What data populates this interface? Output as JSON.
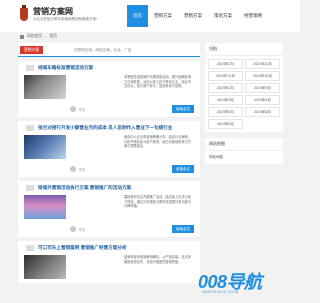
{
  "site": {
    "title": "营销方案网",
    "subtitle": "为企业老板分享实用营销策划和营销方案!"
  },
  "nav": [
    "首页",
    "营销方案",
    "营销方案",
    "策划方案",
    "经营策略"
  ],
  "breadcrumb": [
    "网站首页",
    "首页"
  ],
  "tabs": {
    "active": "营销方案",
    "marquee": "互联网文案、网络文案、社会、广告"
  },
  "posts": [
    {
      "title": "线城车路标准营销活动方案",
      "text": "本季度在各线城市开展营销活动，提升品牌影响力与销售额。活动以线上线下联动为主，结合节日热点，吸引用户参与，促进转化与复购。",
      "author": "佚名",
      "tag": "",
      "read": "阅读全文"
    },
    {
      "title": "张月对接行开发小额营业月的成本 员人员制作入营业下一句提行业",
      "text": "面向中小企业的营销策略分享，结合行业案例，分析市场机会与用户需求，给出可落地的执行方案与预算建议。",
      "author": "佚名",
      "tag": "",
      "read": "阅读全文"
    },
    {
      "title": "短城外营销活动执行方案 营销推广的活动方案",
      "text": "围绕城市社区开展推广活动，结合线上引流与线下体验，通过分享奖励与限时优惠提升参与度与口碑传播。",
      "author": "佚名",
      "tag": "",
      "read": "阅读全文"
    },
    {
      "title": "可口可乐上营销案例 营销推广经营方案分析",
      "text": "品牌年轻化营销案例解析，从产品包装、社交传播到渠道合作，总结可借鉴的营销思路。",
      "author": "佚名",
      "tag": "",
      "read": ""
    }
  ],
  "sidebar": {
    "archive_title": "归档",
    "archive": [
      "2024年2月",
      "2024年11月",
      "2024年12月",
      "2024年10月",
      "2024年1月",
      "2024年9月",
      "2024年3月",
      "2024年4月",
      "2024年5月",
      "2024年8月",
      "2024年6月"
    ],
    "links_title": "网站地图",
    "links": [
      "网站地图"
    ]
  },
  "watermark": {
    "big": "008导航",
    "small": "008TOOLS.COM"
  },
  "colors": {
    "accent": "#1e8fe1",
    "tag": "#d9362a"
  }
}
